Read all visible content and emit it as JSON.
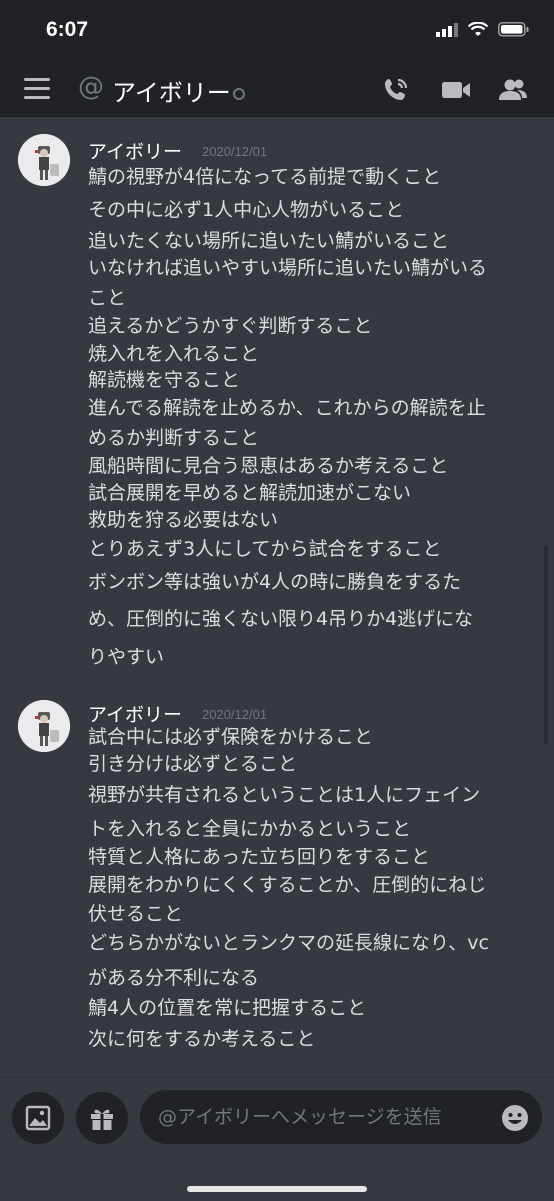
{
  "status_bar": {
    "time": "6:07"
  },
  "header": {
    "at_symbol": "@",
    "channel_name": "アイボリー"
  },
  "messages": [
    {
      "username": "アイボリー",
      "timestamp": "2020/12/01",
      "lines": [
        "鯖の視野が4倍になってる前提で動くこと",
        "その中に必ず1人中心人物がいること",
        "追いたくない場所に追いたい鯖がいること",
        "いなければ追いやすい場所に追いたい鯖がいる",
        "こと",
        "追えるかどうかすぐ判断すること",
        "焼入れを入れること",
        "解読機を守ること",
        "進んでる解読を止めるか、これからの解読を止",
        "めるか判断すること",
        "風船時間に見合う恩恵はあるか考えること",
        "試合展開を早めると解読加速がこない",
        "救助を狩る必要はない",
        "とりあえず3人にしてから試合をすること",
        "ボンボン等は強いが4人の時に勝負をするた",
        "め、圧倒的に強くない限り4吊りか4逃げにな",
        "りやすい"
      ]
    },
    {
      "username": "アイボリー",
      "timestamp": "2020/12/01",
      "lines": [
        "試合中には必ず保険をかけること",
        "引き分けは必ずとること",
        "視野が共有されるということは1人にフェイン",
        "トを入れると全員にかかるということ",
        "特質と人格にあった立ち回りをすること",
        "展開をわかりにくくすることか、圧倒的にねじ",
        "伏せること",
        "どちらかがないとランクマの延長線になり、vc",
        "がある分不利になる",
        "鯖4人の位置を常に把握すること",
        "次に何をするか考えること"
      ]
    }
  ],
  "composer": {
    "placeholder": "@アイボリーへメッセージを送信"
  },
  "colors": {
    "background": "#36393f",
    "header": "#202225",
    "text": "#dcddde",
    "muted": "#72767d"
  }
}
